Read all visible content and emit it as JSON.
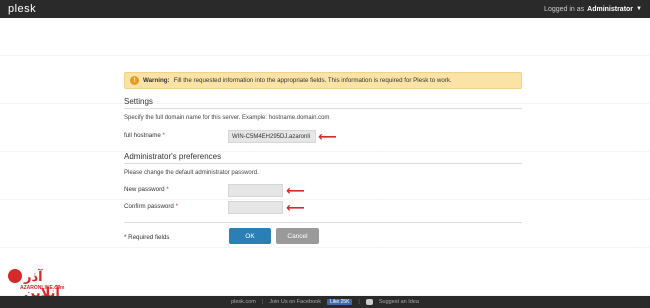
{
  "header": {
    "logo": "plesk",
    "logged_in_as": "Logged in as",
    "user": "Administrator"
  },
  "warning": {
    "strong": "Warning:",
    "text": "Fill the requested information into the appropriate fields. This information is required for Plesk to work."
  },
  "settings": {
    "title": "Settings",
    "description": "Specify the full domain name for this server. Example: hostname.domain.com",
    "hostname_label": "full hostname",
    "hostname_value": "WIN-C5M4EH295DJ.azaronli"
  },
  "admin": {
    "title": "Administrator's preferences",
    "description": "Please change the default administrator password.",
    "new_password_label": "New password",
    "confirm_password_label": "Confirm password"
  },
  "form": {
    "required_note": "* Required fields",
    "ok_label": "OK",
    "cancel_label": "Cancel"
  },
  "brand": {
    "main": "آذر آنلاین",
    "sub": "AZARONLINE.com"
  },
  "footer": {
    "site": "plesk.com",
    "facebook": "Join Us on Facebook",
    "like": "Like 25K",
    "suggest": "Suggest an Idea"
  },
  "colors": {
    "topbar": "#2a2a2a",
    "warning_bg": "#fbe3a5",
    "ok_button": "#2a7fb5",
    "cancel_button": "#9a9a9a",
    "arrow": "#d62a2a"
  }
}
